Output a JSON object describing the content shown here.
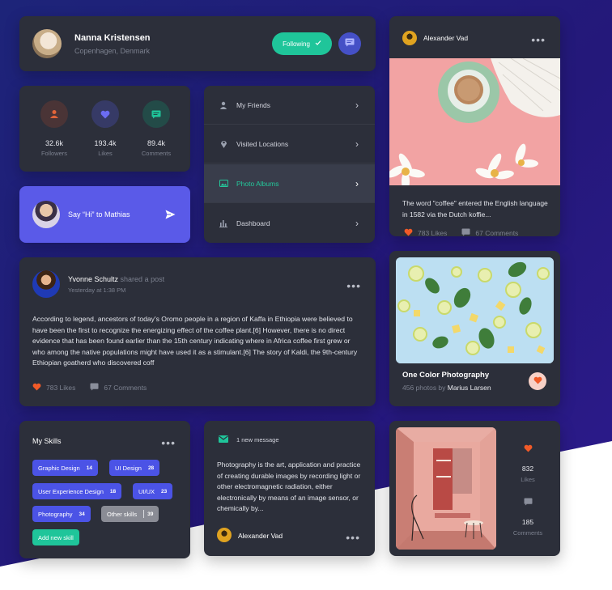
{
  "profile": {
    "name": "Nanna Kristensen",
    "location": "Copenhagen, Denmark",
    "follow_label": "Following"
  },
  "stats": [
    {
      "value": "32.6k",
      "label": "Followers",
      "icon": "user-icon",
      "color": "#e0643a"
    },
    {
      "value": "193.4k",
      "label": "Likes",
      "icon": "heart-icon",
      "color": "#5a5ae8"
    },
    {
      "value": "89.4k",
      "label": "Comments",
      "icon": "comment-icon",
      "color": "#1fc59a"
    }
  ],
  "say_hi": {
    "text": "Say “Hi” to Mathias"
  },
  "menu": {
    "items": [
      {
        "label": "My Friends",
        "icon": "person-icon"
      },
      {
        "label": "Visited Locations",
        "icon": "map-pin-icon"
      },
      {
        "label": "Photo Albums",
        "icon": "image-icon",
        "active": true
      },
      {
        "label": "Dashboard",
        "icon": "bar-chart-icon"
      }
    ]
  },
  "post": {
    "author": "Yvonne Schultz",
    "action": " shared a post",
    "time": "Yesterday at 1:38 PM",
    "body": "According to legend, ancestors of today's Oromo people in a region of Kaffa in Ethiopia were believed to have been the first to recognize the energizing effect of the coffee plant.[6] However, there is no direct evidence that has been found earlier than the 15th century indicating where in Africa coffee first grew or who among the native populations might have used it as a stimulant.[6] The story of Kaldi, the 9th-century Ethiopian goatherd who discovered coff",
    "likes": "783 Likes",
    "comments": "67 Comments"
  },
  "feed": {
    "author": "Alexander Vad",
    "desc": "The word \"coffee\" entered the English language in 1582 via the Dutch koffie...",
    "likes": "783 Likes",
    "comments": "67 Comments"
  },
  "photography": {
    "title": "One Color Photography",
    "count": "456 photos by ",
    "by": "Marius Larsen"
  },
  "skills": {
    "title": "My Skills",
    "chips": [
      {
        "label": "Graphic Design",
        "count": "14"
      },
      {
        "label": "UI Design",
        "count": "28"
      },
      {
        "label": "User Experience Design",
        "count": "18"
      },
      {
        "label": "UI/UX",
        "count": "23"
      },
      {
        "label": "Photography",
        "count": "34"
      },
      {
        "label": "Other skills",
        "count": "39"
      }
    ],
    "add_label": "Add new skill"
  },
  "message": {
    "head": "1 new message",
    "body": "Photography is the art, application and practice of creating durable images by recording light or other electromagnetic radiation, either electronically by means of an image sensor, or chemically by...",
    "author": "Alexander Vad"
  },
  "room": {
    "likes_value": "832",
    "likes_label": "Likes",
    "comments_value": "185",
    "comments_label": "Comments"
  },
  "colors": {
    "accent_green": "#1fc59a",
    "accent_blue": "#5a5ae8",
    "heart_red": "#f05a28",
    "card_bg": "#2c2f3a"
  }
}
